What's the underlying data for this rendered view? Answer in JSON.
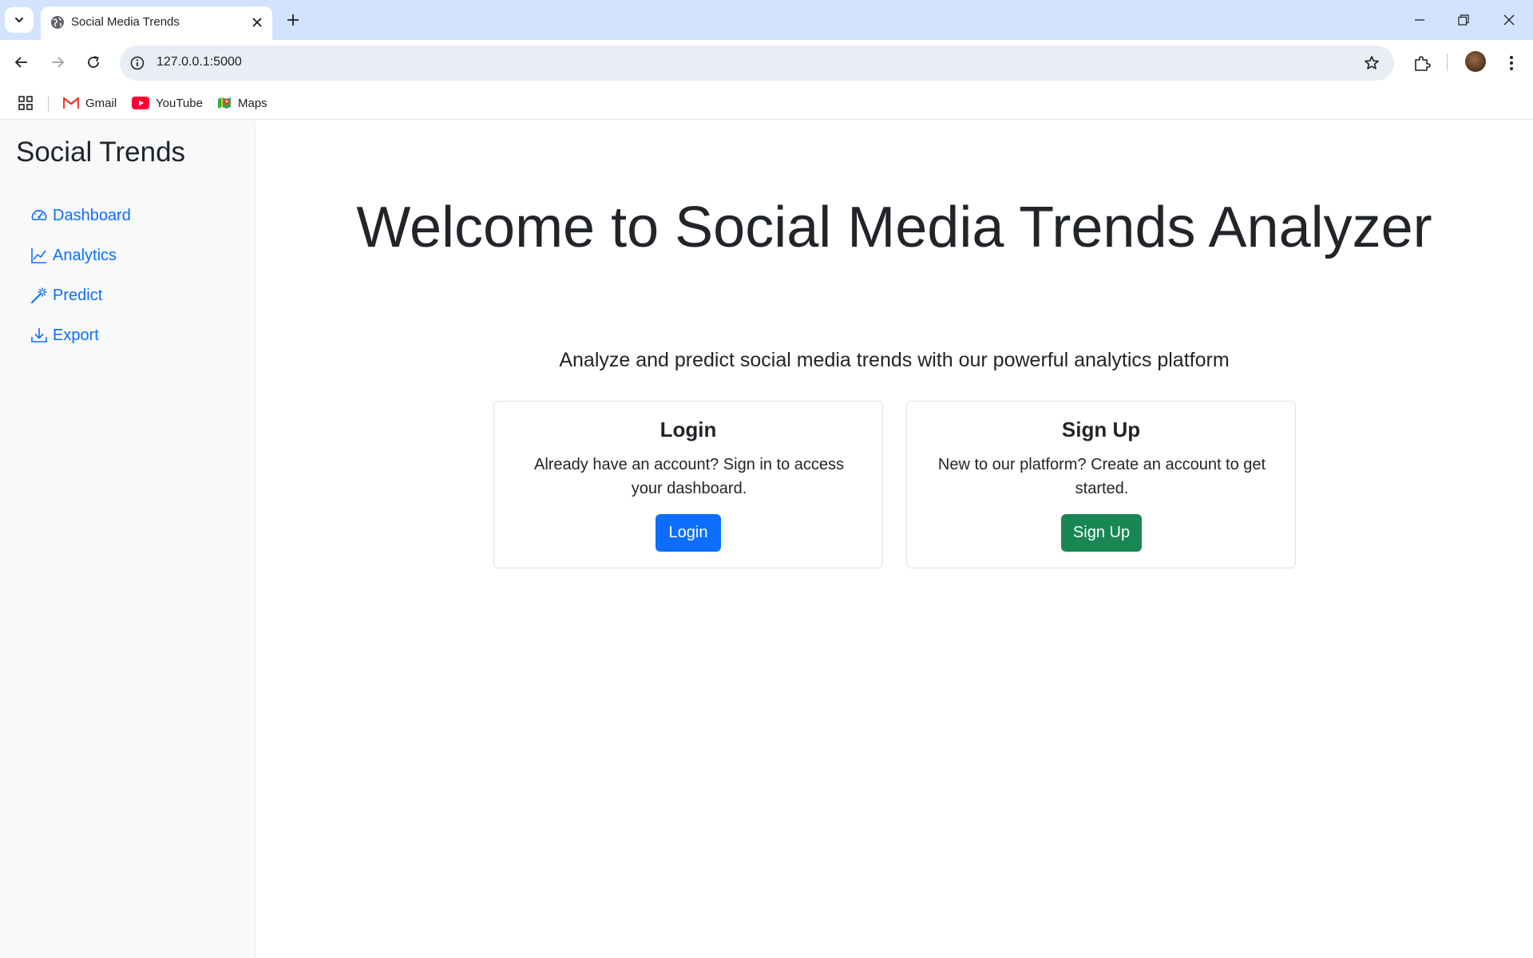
{
  "browser": {
    "tab_title": "Social Media Trends",
    "url": "127.0.0.1:5000",
    "bookmarks": [
      {
        "label": "Gmail",
        "icon": "gmail-icon"
      },
      {
        "label": "YouTube",
        "icon": "youtube-icon"
      },
      {
        "label": "Maps",
        "icon": "maps-icon"
      }
    ]
  },
  "sidebar": {
    "brand": "Social Trends",
    "items": [
      {
        "label": "Dashboard",
        "icon": "speedometer-icon"
      },
      {
        "label": "Analytics",
        "icon": "line-chart-icon"
      },
      {
        "label": "Predict",
        "icon": "magic-wand-icon"
      },
      {
        "label": "Export",
        "icon": "download-icon"
      }
    ]
  },
  "hero": {
    "title": "Welcome to Social Media Trends Analyzer",
    "lead": "Analyze and predict social media trends with our powerful analytics platform"
  },
  "cards": {
    "login": {
      "title": "Login",
      "text": "Already have an account? Sign in to access your dashboard.",
      "button": "Login"
    },
    "signup": {
      "title": "Sign Up",
      "text": "New to our platform? Create an account to get started.",
      "button": "Sign Up"
    }
  },
  "colors": {
    "primary": "#0d6efd",
    "success": "#198754",
    "sidebar_bg": "#f8f9fa",
    "tabstrip_bg": "#d3e3fd"
  }
}
